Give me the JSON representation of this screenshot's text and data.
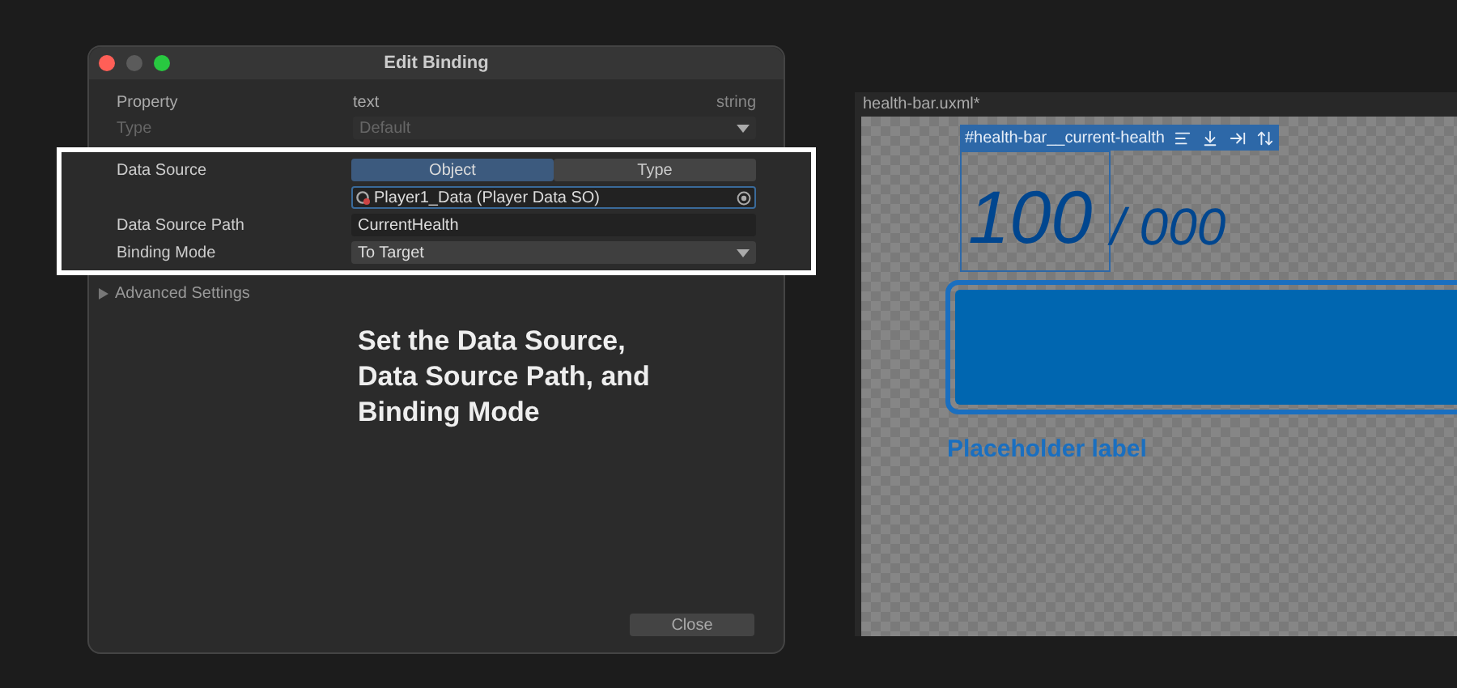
{
  "dialog": {
    "title": "Edit Binding",
    "window_controls": [
      {
        "color": "#ff5f57"
      },
      {
        "color": "#5b5b5b"
      },
      {
        "color": "#28c840"
      }
    ],
    "property": {
      "label": "Property",
      "value": "text",
      "type_hint": "string"
    },
    "type": {
      "label": "Type",
      "value": "Default",
      "disabled": true
    },
    "data_source": {
      "label": "Data Source",
      "tabs": [
        {
          "label": "Object",
          "selected": true
        },
        {
          "label": "Type",
          "selected": false
        }
      ],
      "object_value": "Player1_Data (Player Data SO)"
    },
    "data_source_path": {
      "label": "Data Source Path",
      "value": "CurrentHealth"
    },
    "binding_mode": {
      "label": "Binding Mode",
      "value": "To Target"
    },
    "advanced_settings": {
      "label": "Advanced Settings",
      "expanded": false
    },
    "annotation_lines": [
      "Set the Data Source,",
      "Data Source Path, and",
      "Binding Mode"
    ],
    "close_button": "Close"
  },
  "canvas": {
    "tab": "health-bar.uxml*",
    "selection_label": "#health-bar__current-health",
    "current_health": "100",
    "max_health": "/ 000",
    "placeholder_label": "Placeholder label"
  }
}
